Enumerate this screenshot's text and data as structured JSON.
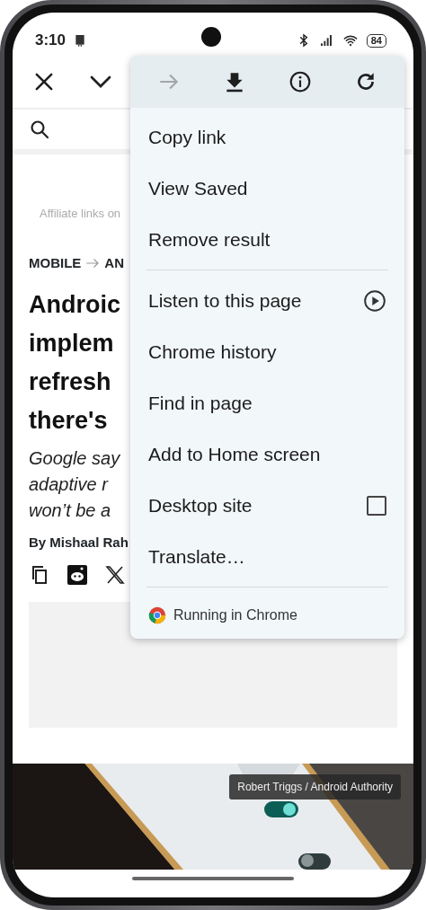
{
  "status_bar": {
    "time": "3:10",
    "battery": "84"
  },
  "article": {
    "affiliate_note": "Affiliate links on",
    "breadcrumb": [
      "MOBILE",
      "AN"
    ],
    "headline": "Androic\nimplem\nrefresh\nthere's",
    "subtitle": "Google say\nadaptive r\nwon’t be a",
    "byline": "By Mishaal Rah",
    "photo_credit": "Robert Triggs / Android Authority"
  },
  "menu": {
    "actions": [
      {
        "kind": "forward",
        "disabled": true
      },
      {
        "kind": "download",
        "disabled": false
      },
      {
        "kind": "info",
        "disabled": false
      },
      {
        "kind": "reload",
        "disabled": false
      }
    ],
    "sections": [
      [
        {
          "label": "Copy link"
        },
        {
          "label": "View Saved"
        },
        {
          "label": "Remove result"
        }
      ],
      [
        {
          "label": "Listen to this page",
          "kind": "play"
        },
        {
          "label": "Chrome history"
        },
        {
          "label": "Find in page"
        },
        {
          "label": "Add to Home screen"
        },
        {
          "label": "Desktop site",
          "kind": "checkbox",
          "checked": false
        },
        {
          "label": "Translate…"
        }
      ]
    ],
    "footer": "Running in Chrome"
  }
}
